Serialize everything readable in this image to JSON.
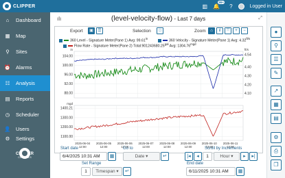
{
  "app": {
    "brand": "CLIPPER",
    "brand_sub": "CONTROLS"
  },
  "topbar": {
    "notif_badge": "99+",
    "user_label": "Logged in User"
  },
  "sidebar": {
    "items": [
      {
        "label": "Dashboard",
        "icon": "⌂"
      },
      {
        "label": "Map",
        "icon": "▦"
      },
      {
        "label": "Sites",
        "icon": "⚲"
      },
      {
        "label": "Alarms",
        "icon": "⏰"
      },
      {
        "label": "Analysis",
        "icon": "☷"
      },
      {
        "label": "Reports",
        "icon": "▤"
      },
      {
        "label": "Scheduler",
        "icon": "◷"
      }
    ],
    "bottom": [
      {
        "label": "Users",
        "icon": "👤"
      },
      {
        "label": "Settings",
        "icon": "⚙"
      }
    ]
  },
  "page": {
    "title": "(level-velocity-flow)",
    "subtitle": " - Last 7 days"
  },
  "toolbar": {
    "export_label": "Export",
    "selection_label": "Selection",
    "zoom_label": "Zoom"
  },
  "legend": {
    "series1": "360 Level - Signature Meter(Pane 1) Avg: 99.61",
    "series1_unit": "in",
    "series2": "360 Velocity - Signature Meter(Pane 1) Avg: 4.32",
    "series2_unit": "ft/s",
    "series3": "Flow Rate - Signature Meter(Pane 2) Total:901243680.25",
    "series3_unit": "gal",
    "series3_avg": "Avg: 1304.76",
    "series3_avg_unit": "mgd"
  },
  "controls": {
    "start_date_label": "Start date",
    "start_date_value": "6/4/2025 10:31 AM",
    "goto_label": "Go to",
    "goto_value": "Date",
    "scroll_label": "Scroll by Increments",
    "scroll_count": "1",
    "scroll_unit": "Hour",
    "set_range_label": "Set Range",
    "range_count": "1",
    "range_unit": "Timespan",
    "end_date_label": "End date",
    "end_date_value": "6/11/2025 10:31 AM"
  },
  "colors": {
    "topbar": "#1f6f9c",
    "sidebar": "#4a6570",
    "active": "#1f8fd0",
    "level": "#1a8c1a",
    "velocity": "#1a2aa8",
    "flow": "#c0221e"
  },
  "chart_data": [
    {
      "type": "line",
      "title": "",
      "y_left": {
        "label": "in",
        "ticks": [
          "104.00",
          "100.00",
          "96.00",
          "92.00",
          "88.00"
        ],
        "ylim": [
          86,
          106
        ]
      },
      "y_right": {
        "label": "ft/s",
        "ticks": [
          "4.54",
          "4.40",
          "4.30",
          "4.20",
          "4.10"
        ],
        "ylim": [
          4.05,
          4.58
        ]
      },
      "series": [
        {
          "name": "360 Level - Signature Meter(Pane 1)",
          "axis": "left",
          "values": [
            96.0,
            95.5,
            96.0,
            96.5,
            97.0,
            97.5,
            98.0,
            98.5,
            99.0,
            99.5,
            100.0,
            100.5,
            101.0,
            101.2,
            98.0,
            101.5,
            101.8,
            102.0
          ]
        },
        {
          "name": "360 Velocity - Signature Meter(Pane 1)",
          "axis": "right",
          "values": [
            4.47,
            4.48,
            4.49,
            4.49,
            4.5,
            4.5,
            4.5,
            4.51,
            4.51,
            4.52,
            4.52,
            4.52,
            4.52,
            4.53,
            4.15,
            4.54,
            4.54,
            4.54
          ]
        }
      ]
    },
    {
      "type": "line",
      "title": "",
      "y_left": {
        "label": "mgd",
        "ticks": [
          "1400.21",
          "1300.00",
          "1200.00",
          "1100.00"
        ],
        "ylim": [
          1060,
          1430
        ]
      },
      "x_ticks": [
        "2025-06-04 12:00",
        "2025-06-05 12:00",
        "2025-06-06 12:00",
        "2025-06-07 12:00",
        "2025-06-08 12:00",
        "2025-06-09 12:00",
        "2025-06-10 12:00",
        "2025-06-11 12:00"
      ],
      "series": [
        {
          "name": "Flow Rate - Signature Meter(Pane 2)",
          "axis": "left",
          "values": [
            1180,
            1190,
            1205,
            1215,
            1230,
            1245,
            1260,
            1270,
            1285,
            1295,
            1305,
            1315,
            1320,
            1330,
            1100,
            1340,
            1355,
            1370
          ]
        }
      ]
    }
  ]
}
